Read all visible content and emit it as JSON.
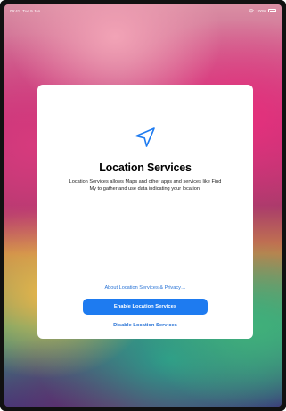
{
  "status_bar": {
    "time": "09:41",
    "date": "Tue 9 Jan",
    "battery": "100%"
  },
  "dialog": {
    "icon": "location-arrow-icon",
    "title": "Location Services",
    "description": "Location Services allows Maps and other apps and services like Find My to gather and use data indicating your location.",
    "privacy_link": "About Location Services & Privacy…",
    "enable_button": "Enable Location Services",
    "disable_button": "Disable Location Services"
  },
  "colors": {
    "accent": "#1e7bf0",
    "link": "#2a74d6"
  }
}
